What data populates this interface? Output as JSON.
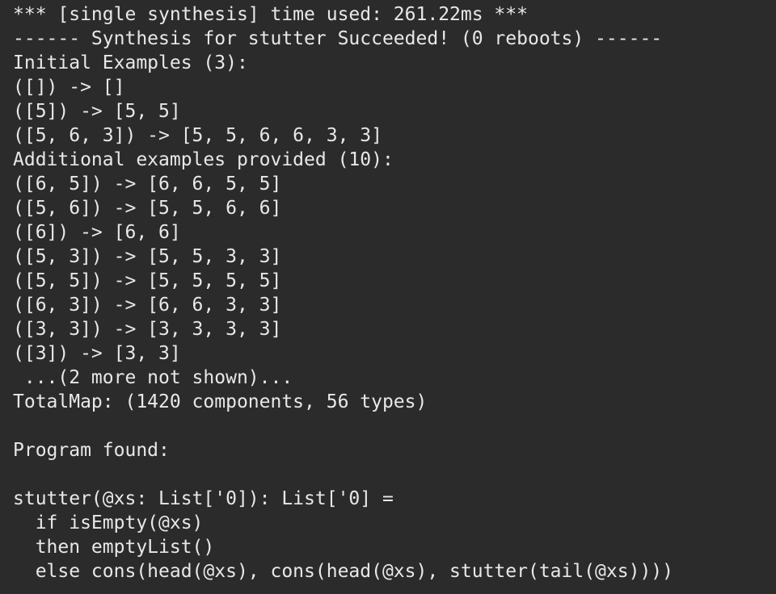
{
  "terminal": {
    "lines": [
      "*** [single synthesis] time used: 261.22ms ***",
      "------ Synthesis for stutter Succeeded! (0 reboots) ------",
      "Initial Examples (3):",
      "([]) -> []",
      "([5]) -> [5, 5]",
      "([5, 6, 3]) -> [5, 5, 6, 6, 3, 3]",
      "Additional examples provided (10):",
      "([6, 5]) -> [6, 6, 5, 5]",
      "([5, 6]) -> [5, 5, 6, 6]",
      "([6]) -> [6, 6]",
      "([5, 3]) -> [5, 5, 3, 3]",
      "([5, 5]) -> [5, 5, 5, 5]",
      "([6, 3]) -> [6, 6, 3, 3]",
      "([3, 3]) -> [3, 3, 3, 3]",
      "([3]) -> [3, 3]",
      " ...(2 more not shown)...",
      "TotalMap: (1420 components, 56 types)",
      "",
      "Program found:",
      "",
      "stutter(@xs: List['0]): List['0] =",
      "  if isEmpty(@xs)",
      "  then emptyList()",
      "  else cons(head(@xs), cons(head(@xs), stutter(tail(@xs))))"
    ],
    "colors": {
      "background": "#2b2b2b",
      "text": "#e8e8e8"
    }
  }
}
